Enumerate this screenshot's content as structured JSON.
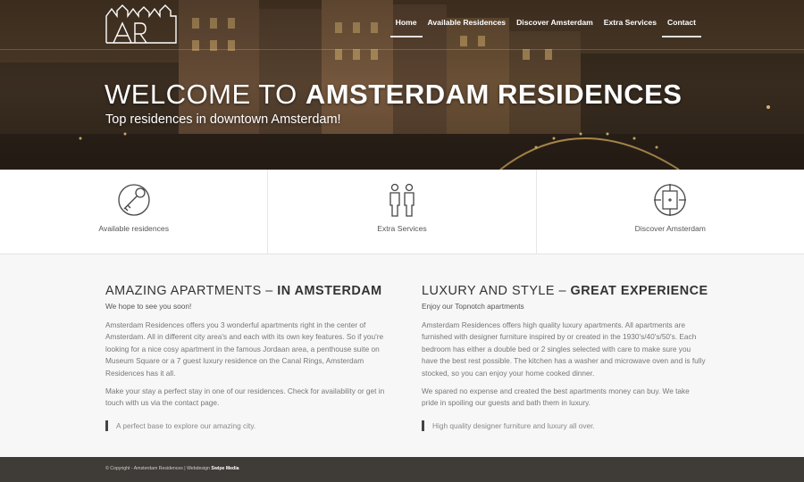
{
  "nav": {
    "items": [
      {
        "label": "Home"
      },
      {
        "label": "Available Residences"
      },
      {
        "label": "Discover Amsterdam"
      },
      {
        "label": "Extra Services"
      },
      {
        "label": "Contact"
      }
    ]
  },
  "hero": {
    "title_light": "WELCOME TO",
    "title_bold": "AMSTERDAM RESIDENCES",
    "subtitle": "Top residences in downtown Amsterdam!"
  },
  "features": [
    {
      "label": "Available residences",
      "icon": "key-icon"
    },
    {
      "label": "Extra Services",
      "icon": "people-icon"
    },
    {
      "label": "Discover Amsterdam",
      "icon": "compass-icon"
    }
  ],
  "left": {
    "heading_light": "AMAZING APARTMENTS –",
    "heading_bold": "IN AMSTERDAM",
    "tagline": "We hope to see you soon!",
    "p1": "Amsterdam Residences offers you 3 wonderful apartments right in the center of Amsterdam. All in different city area's and each with its own key features. So if you're looking for a nice cosy apartment in the famous Jordaan area, a penthouse suite on Museum Square or a 7 guest luxury residence on the Canal Rings, Amsterdam Residences has it all.",
    "p2": "Make your stay a perfect stay in one of our residences. Check for availability or get in touch with us via the contact page.",
    "quote": "A perfect base to explore our amazing city."
  },
  "right": {
    "heading_light": "LUXURY AND STYLE –",
    "heading_bold": "GREAT EXPERIENCE",
    "tagline": "Enjoy our Topnotch apartments",
    "p1": "Amsterdam Residences offers high quality luxury apartments. All apartments are furnished with designer furniture inspired by or created in the 1930's/40's/50's. Each bedroom has either a double bed or 2 singles selected with care to make sure you have the best rest possible. The kitchen has a washer and microwave oven and is fully stocked, so you can enjoy your home cooked dinner.",
    "p2": "We spared no expense and created the best apartments money can buy. We take pride in spoiling our guests and bath them in luxury.",
    "quote": "High quality designer furniture and luxury all over."
  },
  "footer": {
    "text": "© Copyright - Amsterdam Residences | Webdesign",
    "credit": "Swipe Media"
  },
  "colors": {
    "footer_bg": "#3f3b37",
    "quote_bar": "#444444"
  }
}
